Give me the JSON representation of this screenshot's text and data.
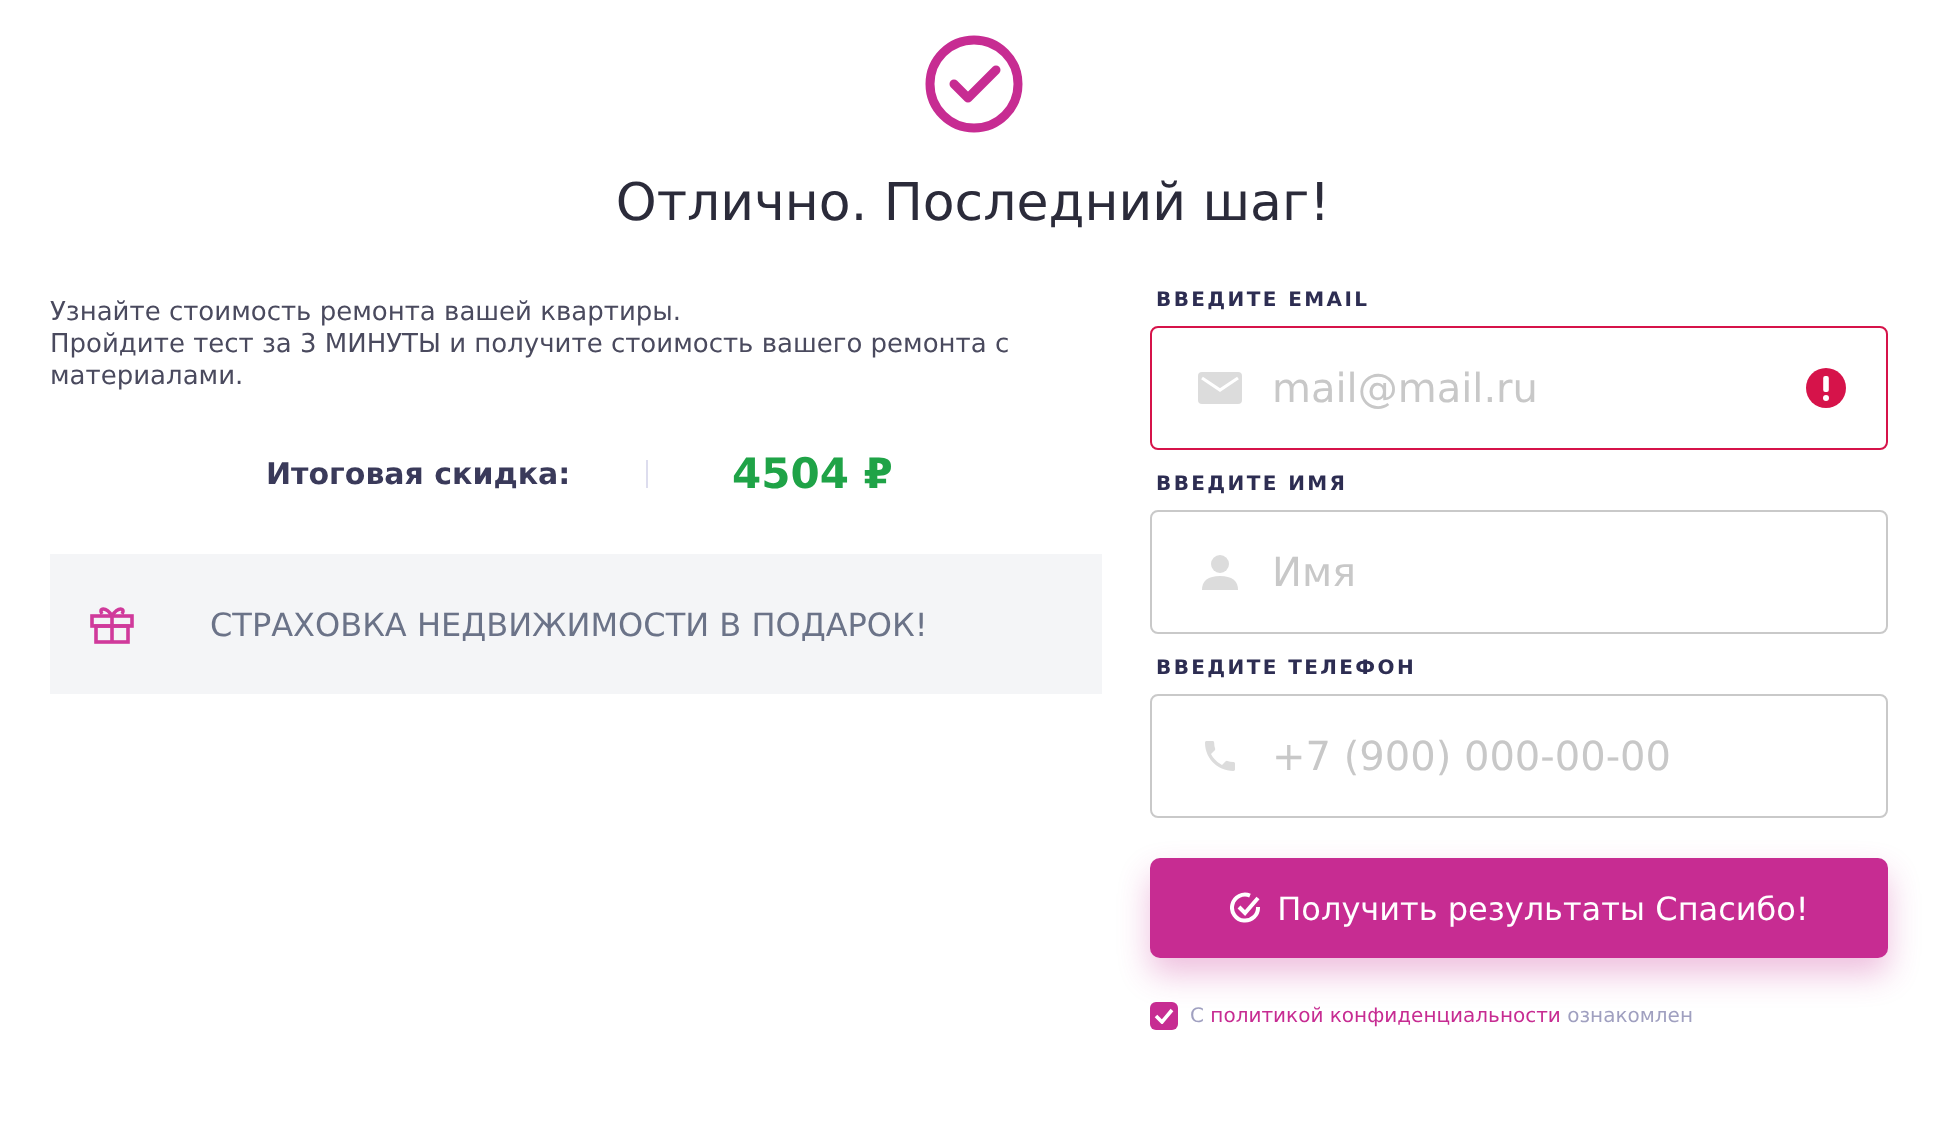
{
  "header": {
    "title": "Отлично. Последний шаг!"
  },
  "intro": {
    "lines": [
      "Узнайте стоимость ремонта вашей квартиры.",
      "Пройдите тест за 3 МИНУТЫ и получите стоимость вашего ремонта с материалами."
    ]
  },
  "discount": {
    "label": "Итоговая скидка:",
    "value": "4504 ₽"
  },
  "bonus": {
    "text": "СТРАХОВКА НЕДВИЖИМОСТИ В ПОДАРОК!"
  },
  "form": {
    "fields": [
      {
        "kind": "email",
        "label": "ВВЕДИТЕ EMAIL",
        "placeholder": "mail@mail.ru",
        "error": true
      },
      {
        "kind": "name",
        "label": "ВВЕДИТЕ ИМЯ",
        "placeholder": "Имя",
        "error": false
      },
      {
        "kind": "phone",
        "label": "ВВЕДИТЕ ТЕЛЕФОН",
        "placeholder": "+7 (900) 000-00-00",
        "error": false
      }
    ],
    "submit": "Получить результаты Спасибо!",
    "consent": {
      "checked": true,
      "before": "С",
      "link": "политикой конфиденциальности",
      "after": "ознакомлен"
    }
  }
}
